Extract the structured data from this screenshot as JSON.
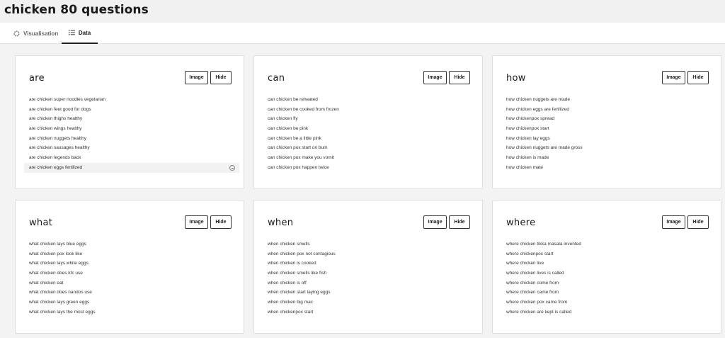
{
  "page": {
    "title": "chicken 80 questions"
  },
  "tabs": [
    {
      "label": "Visualisation",
      "active": false
    },
    {
      "label": "Data",
      "active": true
    }
  ],
  "buttons": {
    "image_label": "Image",
    "hide_label": "Hide"
  },
  "cards": [
    {
      "title": "are",
      "items": [
        "are chicken super noodles vegetarian",
        "are chicken feet good for dogs",
        "are chicken thighs healthy",
        "are chicken wings healthy",
        "are chicken nuggets healthy",
        "are chicken sausages healthy",
        "are chicken legends back",
        "are chicken eggs fertilized"
      ]
    },
    {
      "title": "can",
      "items": [
        "can chicken be reheated",
        "can chicken be cooked from frozen",
        "can chicken fly",
        "can chicken be pink",
        "can chicken be a little pink",
        "can chicken pox start on bum",
        "can chicken pox make you vomit",
        "can chicken pox happen twice"
      ]
    },
    {
      "title": "how",
      "items": [
        "how chicken nuggets are made",
        "how chicken eggs are fertilized",
        "how chickenpox spread",
        "how chickenpox start",
        "how chicken lay eggs",
        "how chicken nuggets are made gross",
        "how chicken is made",
        "how chicken mate"
      ]
    },
    {
      "title": "what",
      "items": [
        "what chicken lays blue eggs",
        "what chicken pox look like",
        "what chicken lays white eggs",
        "what chicken does kfc use",
        "what chicken eat",
        "what chicken does nandos use",
        "what chicken lays green eggs",
        "what chicken lays the most eggs"
      ]
    },
    {
      "title": "when",
      "items": [
        "when chicken smells",
        "when chicken pox not contagious",
        "when chicken is cooked",
        "when chicken smells like fish",
        "when chicken is off",
        "when chicken start laying eggs",
        "when chicken big mac",
        "when chickenpox start"
      ]
    },
    {
      "title": "where",
      "items": [
        "where chicken tikka masala invented",
        "where chickenpox start",
        "where chicken live",
        "where chicken lives is called",
        "where chicken come from",
        "where chicken came from",
        "where chicken pox came from",
        "where chicken are kept is called"
      ]
    }
  ]
}
